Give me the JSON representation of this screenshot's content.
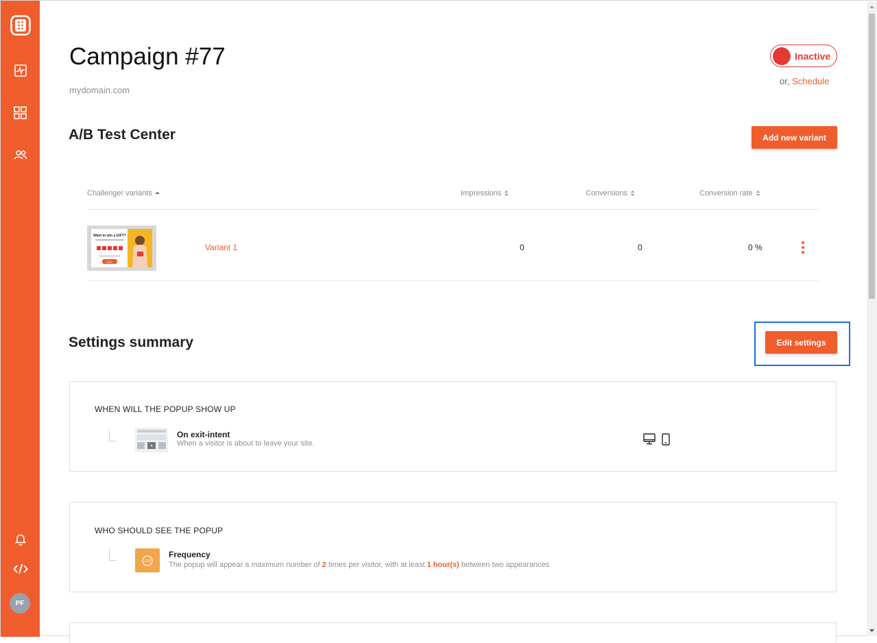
{
  "campaign": {
    "title": "Campaign #77",
    "domain": "mydomain.com"
  },
  "status": {
    "label": "Inactive",
    "or_text": "or,",
    "schedule_label": "Schedule"
  },
  "ab_test": {
    "title": "A/B Test Center",
    "add_variant_label": "Add new variant",
    "columns": [
      "Challenger variants",
      "Impressions",
      "Conversions",
      "Conversion rate"
    ],
    "rows": [
      {
        "name": "Variant 1",
        "impressions": "0",
        "conversions": "0",
        "conversion_rate": "0 %"
      }
    ],
    "thumbnail": {
      "headline": "Want to win a GIFT?",
      "button": "Spin"
    }
  },
  "settings": {
    "title": "Settings summary",
    "edit_label": "Edit settings",
    "when_card": {
      "title": "WHEN WILL THE POPUP SHOW UP",
      "item_title": "On exit-intent",
      "item_desc": "When a visitor is about to leave your site."
    },
    "who_card": {
      "title": "WHO SHOULD SEE THE POPUP",
      "item_title": "Frequency",
      "desc_part1": "The popup will appear a maximum number of ",
      "times_value": "2",
      "desc_part2": " times per visitor, with at least ",
      "interval_value": "1 hour(s)",
      "desc_part3": " between two appearances"
    }
  },
  "user": {
    "initials": "PF"
  },
  "icons": {
    "sidebar": [
      "logo-icon",
      "analytics-icon",
      "dashboard-grid-icon",
      "users-icon",
      "bell-icon",
      "code-icon"
    ],
    "devices": [
      "desktop-icon",
      "mobile-icon"
    ]
  },
  "colors": {
    "brand": "#ef5d2d",
    "status_inactive": "#e53935",
    "focus": "#1e6fd9",
    "frequency_badge": "#f0a64a"
  }
}
